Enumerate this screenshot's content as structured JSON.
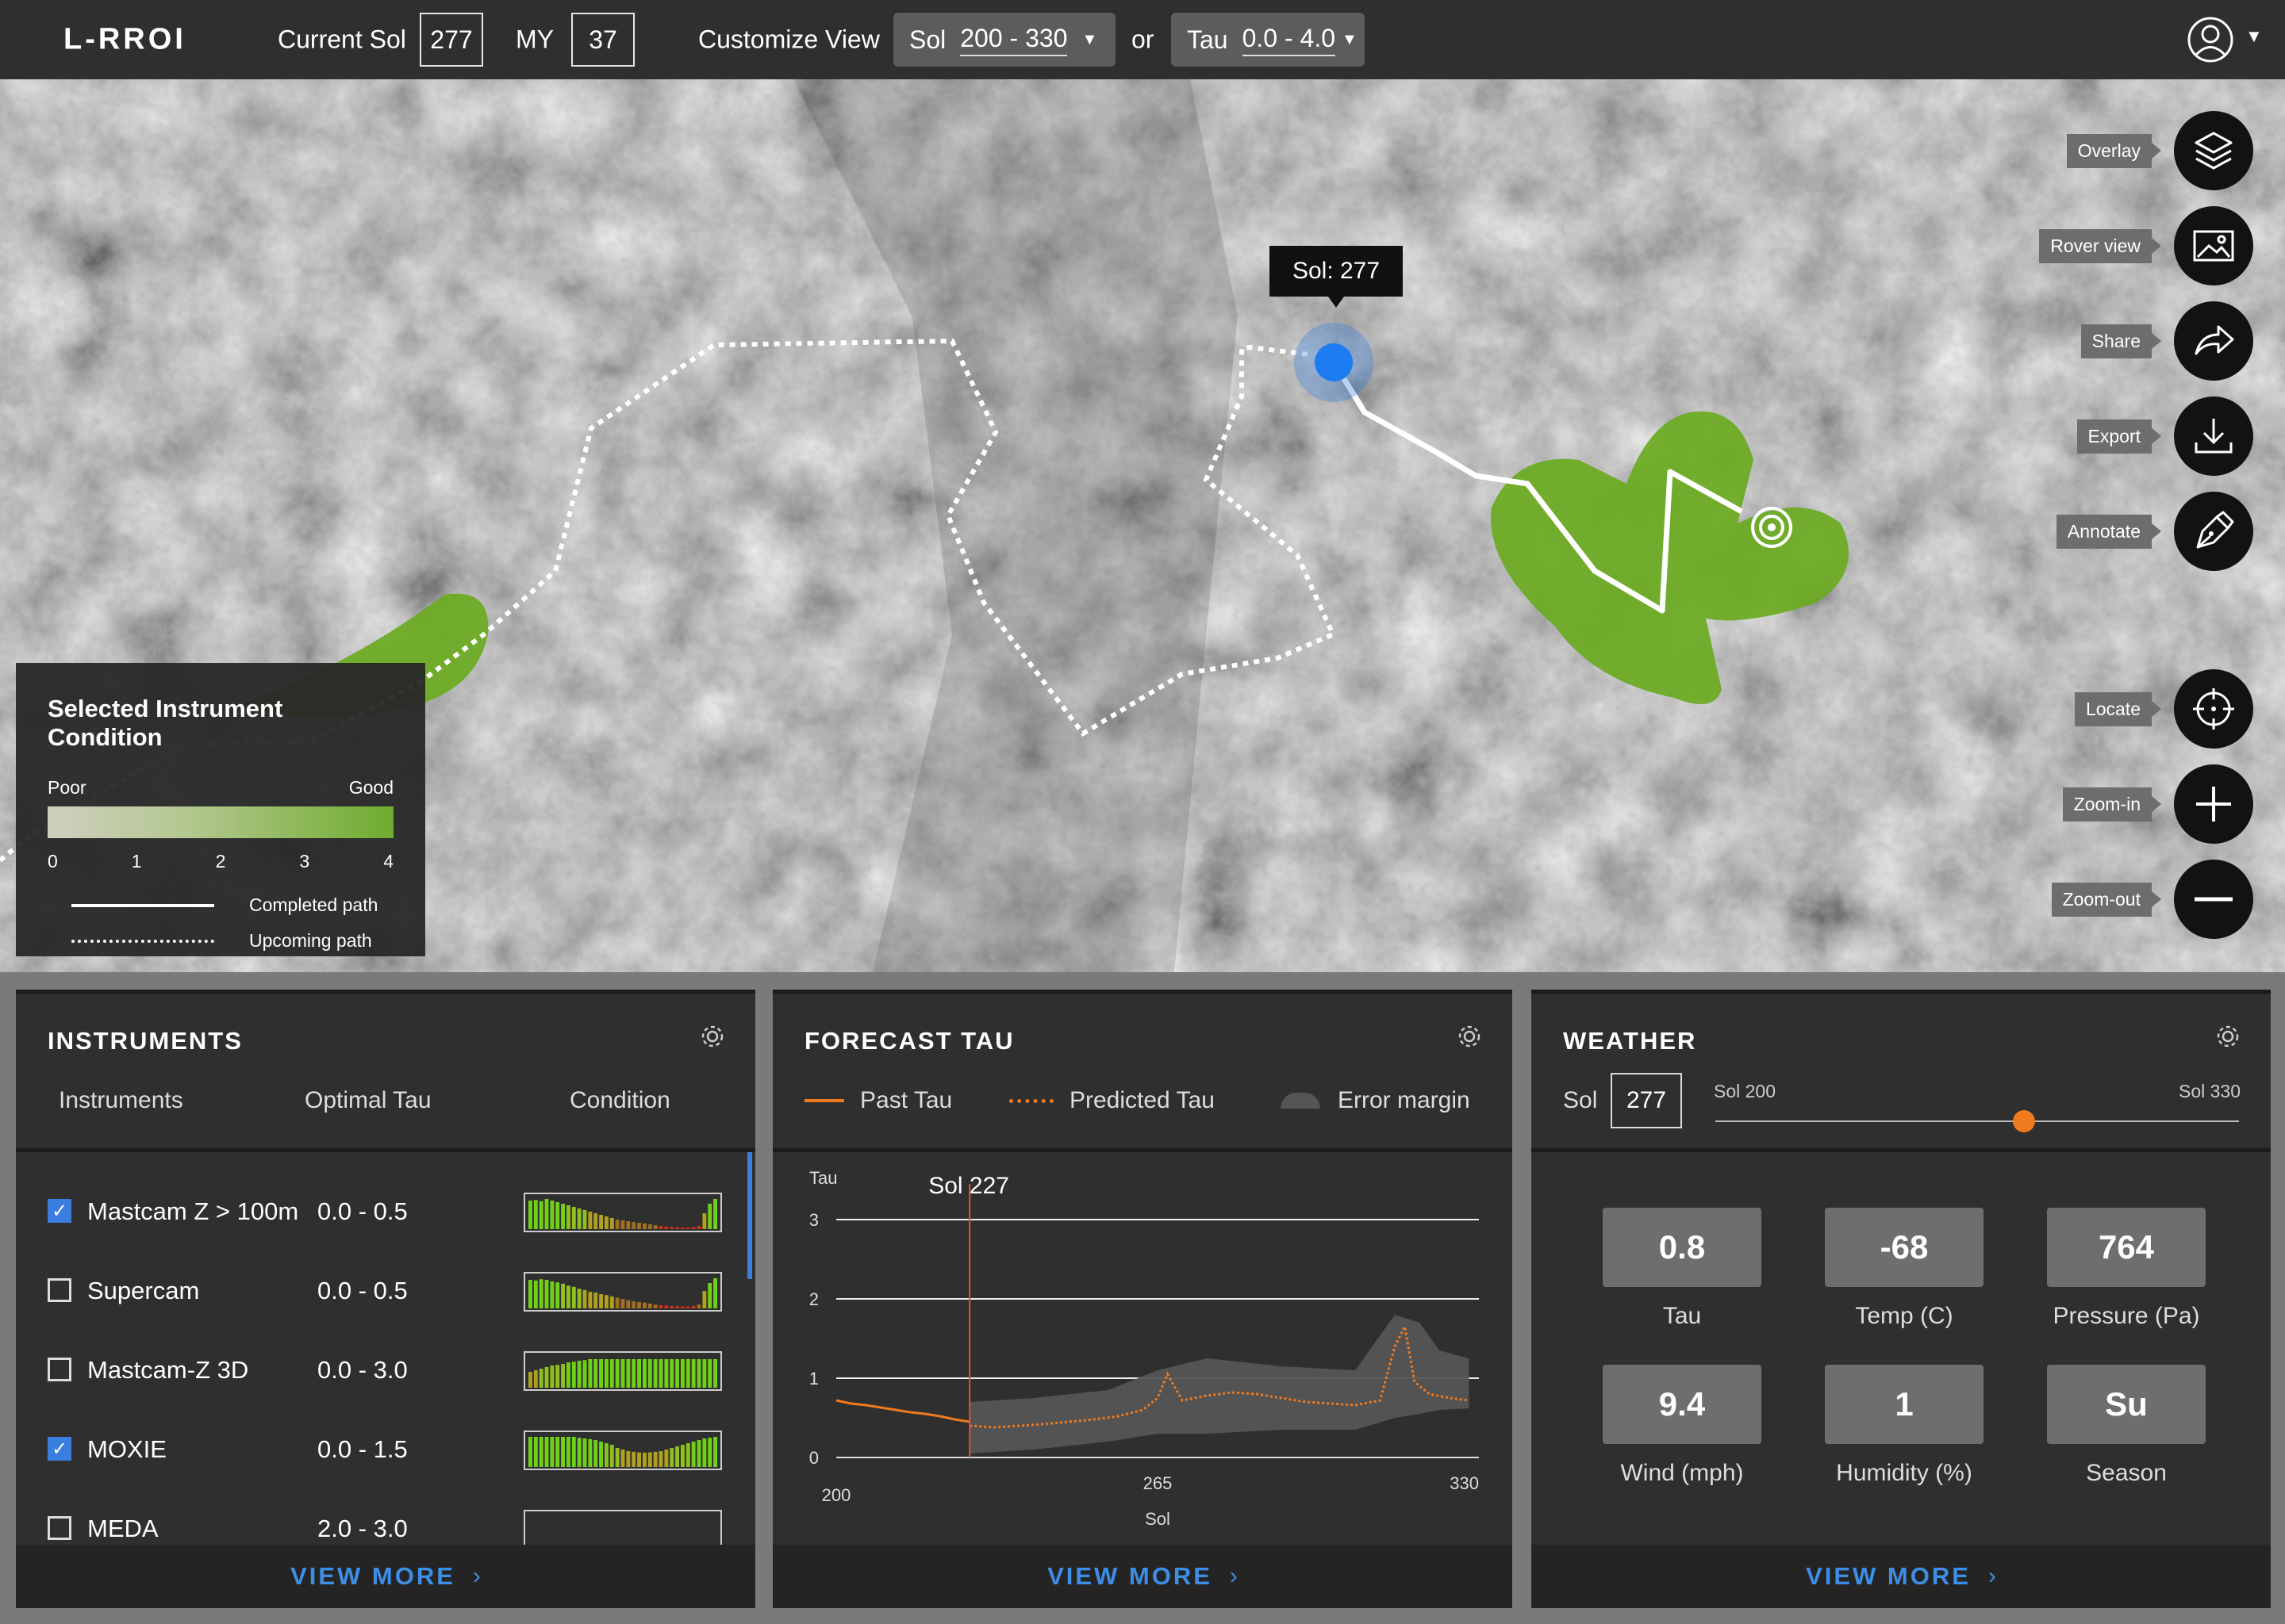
{
  "header": {
    "app_name": "L-RROI",
    "current_sol_label": "Current Sol",
    "current_sol": "277",
    "my_label": "MY",
    "my_value": "37",
    "customize_label": "Customize View",
    "sol_dd_prefix": "Sol",
    "sol_dd_value": "200 - 330",
    "or_label": "or",
    "tau_dd_prefix": "Tau",
    "tau_dd_value": "0.0 - 4.0"
  },
  "map": {
    "sol_tooltip": "Sol: 277",
    "tools": {
      "overlay": "Overlay",
      "rover_view": "Rover view",
      "share": "Share",
      "export": "Export",
      "annotate": "Annotate",
      "locate": "Locate",
      "zoom_in": "Zoom-in",
      "zoom_out": "Zoom-out"
    },
    "legend": {
      "title": "Selected Instrument Condition",
      "poor": "Poor",
      "good": "Good",
      "ticks": [
        "0",
        "1",
        "2",
        "3",
        "4"
      ],
      "completed": "Completed path",
      "upcoming": "Upcoming path"
    }
  },
  "instruments": {
    "title": "INSTRUMENTS",
    "col_instruments": "Instruments",
    "col_tau": "Optimal Tau",
    "col_condition": "Condition",
    "rows": [
      {
        "name": "Mastcam Z > 100m",
        "tau": "0.0 - 0.5",
        "checked": true
      },
      {
        "name": "Supercam",
        "tau": "0.0 - 0.5",
        "checked": false
      },
      {
        "name": "Mastcam-Z 3D",
        "tau": "0.0 - 3.0",
        "checked": false
      },
      {
        "name": "MOXIE",
        "tau": "0.0 - 1.5",
        "checked": true
      },
      {
        "name": "MEDA",
        "tau": "2.0 - 3.0",
        "checked": false
      }
    ],
    "view_more": "VIEW MORE"
  },
  "forecast": {
    "title": "FORECAST TAU",
    "past": "Past Tau",
    "predicted": "Predicted Tau",
    "error": "Error margin",
    "view_more": "VIEW MORE"
  },
  "chart_data": {
    "type": "line",
    "title": "",
    "xlabel": "Sol",
    "ylabel": "Tau",
    "xlim": [
      200,
      330
    ],
    "ylim": [
      0,
      3
    ],
    "x_ticks": [
      "200",
      "265",
      "330"
    ],
    "y_ticks": [
      "0",
      "1",
      "2",
      "3"
    ],
    "marker_label": "Sol 227",
    "marker_x": 227,
    "series": [
      {
        "name": "Past Tau",
        "x": [
          200,
          203,
          206,
          209,
          212,
          215,
          218,
          221,
          224,
          227
        ],
        "y": [
          0.72,
          0.68,
          0.66,
          0.63,
          0.6,
          0.57,
          0.55,
          0.52,
          0.48,
          0.45
        ]
      },
      {
        "name": "Predicted Tau",
        "x": [
          227,
          232,
          237,
          242,
          247,
          252,
          257,
          262,
          265,
          267,
          270,
          275,
          280,
          285,
          290,
          295,
          300,
          305,
          310,
          313,
          315,
          317,
          320,
          324,
          328
        ],
        "y": [
          0.4,
          0.38,
          0.4,
          0.42,
          0.45,
          0.48,
          0.52,
          0.6,
          0.75,
          1.05,
          0.72,
          0.78,
          0.82,
          0.8,
          0.75,
          0.7,
          0.68,
          0.66,
          0.72,
          1.4,
          1.65,
          0.95,
          0.8,
          0.75,
          0.72
        ]
      },
      {
        "name": "Error margin",
        "x": [
          227,
          240,
          255,
          265,
          275,
          290,
          305,
          313,
          318,
          322,
          328
        ],
        "y_low": [
          0.05,
          0.1,
          0.2,
          0.3,
          0.3,
          0.35,
          0.35,
          0.5,
          0.55,
          0.6,
          0.62
        ],
        "y_high": [
          0.7,
          0.75,
          0.85,
          1.1,
          1.25,
          1.15,
          1.1,
          1.8,
          1.7,
          1.35,
          1.25
        ]
      }
    ]
  },
  "weather": {
    "title": "WEATHER",
    "sol_label": "Sol",
    "sol_value": "277",
    "slider_min": "Sol 200",
    "slider_max": "Sol 330",
    "slider_fraction": 0.59,
    "tiles": [
      {
        "value": "0.8",
        "label": "Tau"
      },
      {
        "value": "-68",
        "label": "Temp (C)"
      },
      {
        "value": "764",
        "label": "Pressure (Pa)"
      },
      {
        "value": "9.4",
        "label": "Wind (mph)"
      },
      {
        "value": "1",
        "label": "Humidity (%)"
      },
      {
        "value": "Su",
        "label": "Season"
      }
    ],
    "view_more": "VIEW MORE"
  }
}
